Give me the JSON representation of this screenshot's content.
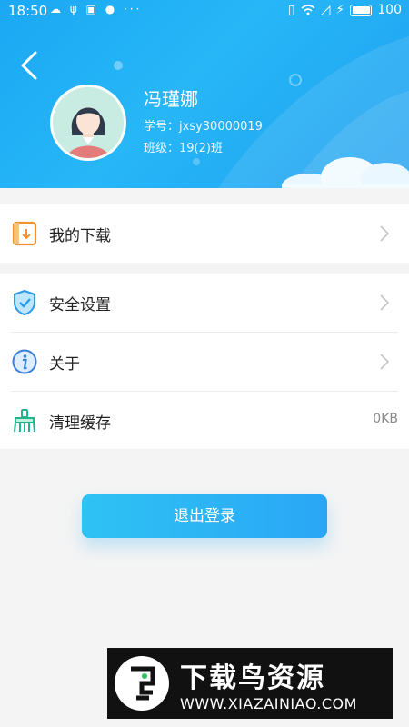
{
  "status_bar": {
    "time": "18:50",
    "left_icons": "☁ ψ ▣ ● ···",
    "battery": "100"
  },
  "profile": {
    "name": "冯瑾娜",
    "student_id": "学号：jxsy30000019",
    "class": "班级：19(2)班"
  },
  "menu": {
    "downloads": "我的下载",
    "security": "安全设置",
    "about": "关于",
    "clear_cache": "清理缓存",
    "cache_size": "0KB"
  },
  "logout_label": "退出登录",
  "watermark": {
    "title": "下载鸟资源",
    "url": "WWW.XIAZAINIAO.COM"
  },
  "colors": {
    "header_blue": "#1aa8f3",
    "button_blue": "#2aa6f5"
  }
}
